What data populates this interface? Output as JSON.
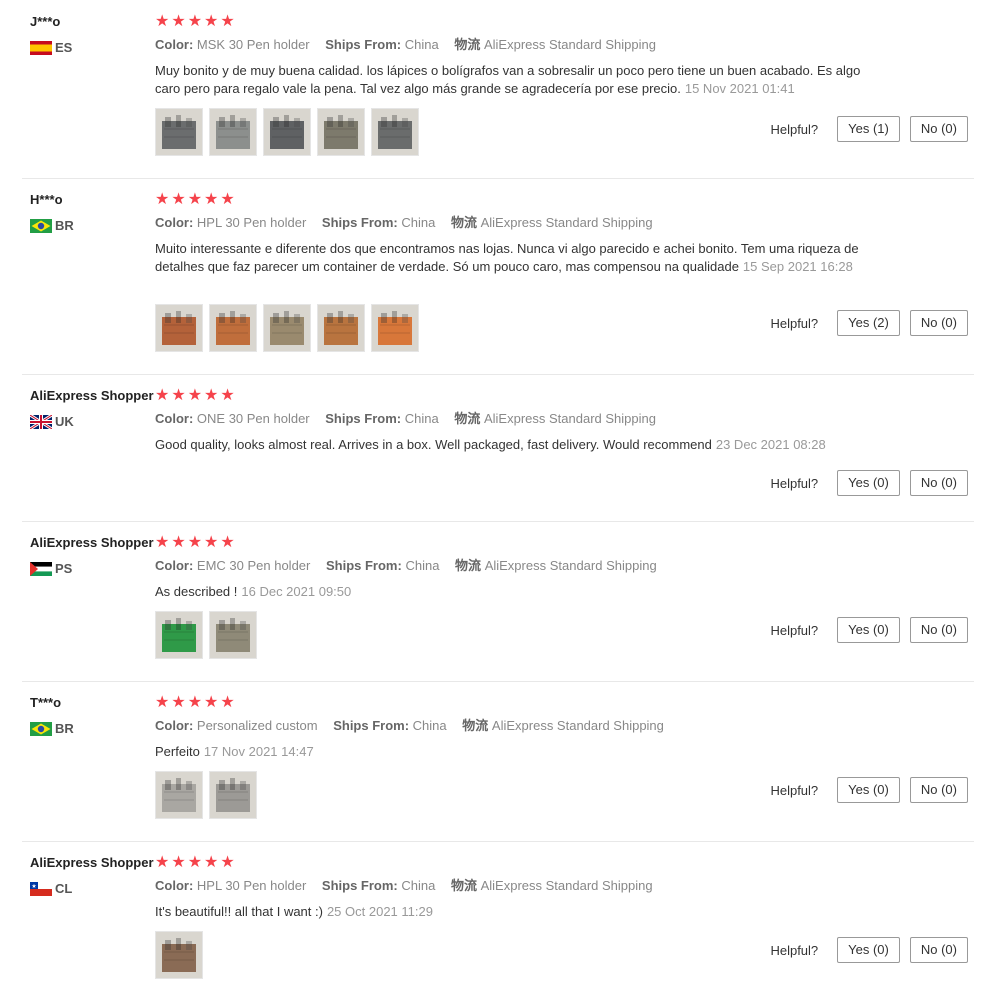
{
  "labels": {
    "color": "Color:",
    "ships_from": "Ships From:",
    "shipping_prefix": "物流",
    "helpful": "Helpful?",
    "stars": "★★★★★"
  },
  "reviews": [
    {
      "user": "J***o",
      "country": "ES",
      "color_value": "MSK 30 Pen holder",
      "ships_from": "China",
      "shipping": "AliExpress Standard Shipping",
      "text": "Muy bonito y de muy buena calidad. los lápices o bolígrafos van a sobresalir un poco pero tiene un buen acabado. Es algo caro pero para regalo vale la pena. Tal vez algo más grande se agradecería por ese precio.",
      "date": "15 Nov 2021 01:41",
      "yes": "Yes (1)",
      "no": "No (0)",
      "photo_colors": [
        "#6b6d6e",
        "#8c8f8d",
        "#5f6163",
        "#7d7a6c",
        "#6a6c6c"
      ]
    },
    {
      "user": "H***o",
      "country": "BR",
      "color_value": "HPL 30 Pen holder",
      "ships_from": "China",
      "shipping": "AliExpress Standard Shipping",
      "text": "Muito interessante e diferente dos que encontramos nas lojas. Nunca vi algo parecido e achei bonito. Tem uma riqueza de detalhes que faz parecer um container de verdade. Só um pouco caro, mas compensou na qualidade",
      "date": "15 Sep 2021 16:28",
      "yes": "Yes (2)",
      "no": "No (0)",
      "photo_colors": [
        "#b4623a",
        "#c06e3c",
        "#9a8a6e",
        "#b9743f",
        "#d8773a"
      ]
    },
    {
      "user": "AliExpress Shopper",
      "country": "UK",
      "color_value": "ONE 30 Pen holder",
      "ships_from": "China",
      "shipping": "AliExpress Standard Shipping",
      "text": "Good quality, looks almost real. Arrives in a box. Well packaged, fast delivery. Would recommend",
      "date": "23 Dec 2021 08:28",
      "yes": "Yes (0)",
      "no": "No (0)",
      "photo_colors": []
    },
    {
      "user": "AliExpress Shopper",
      "country": "PS",
      "color_value": "EMC 30 Pen holder",
      "ships_from": "China",
      "shipping": "AliExpress Standard Shipping",
      "text": "As described !",
      "date": "16 Dec 2021 09:50",
      "yes": "Yes (0)",
      "no": "No (0)",
      "photo_colors": [
        "#2f9a48",
        "#8f8a78"
      ]
    },
    {
      "user": "T***o",
      "country": "BR",
      "color_value": "Personalized custom",
      "ships_from": "China",
      "shipping": "AliExpress Standard Shipping",
      "text": "Perfeito",
      "date": "17 Nov 2021 14:47",
      "yes": "Yes (0)",
      "no": "No (0)",
      "photo_colors": [
        "#a9a7a2",
        "#9c9a96"
      ]
    },
    {
      "user": "AliExpress Shopper",
      "country": "CL",
      "color_value": "HPL 30 Pen holder",
      "ships_from": "China",
      "shipping": "AliExpress Standard Shipping",
      "text": "It's beautiful!! all that I want :)",
      "date": "25 Oct 2021 11:29",
      "yes": "Yes (0)",
      "no": "No (0)",
      "photo_colors": [
        "#8a6b55"
      ]
    }
  ]
}
